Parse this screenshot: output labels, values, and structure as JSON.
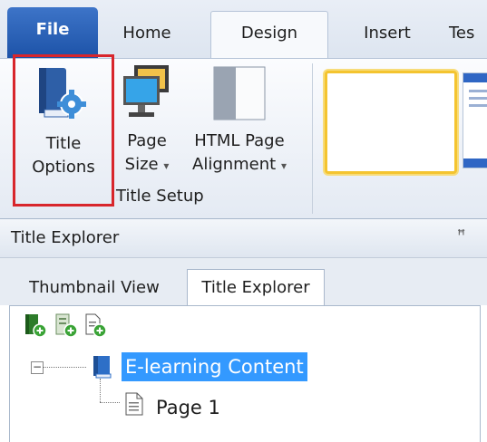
{
  "tabs": {
    "file": "File",
    "home": "Home",
    "design": "Design",
    "insert": "Insert",
    "extra": "Tes"
  },
  "ribbon": {
    "title_options": {
      "line1": "Title",
      "line2": "Options"
    },
    "page_size": {
      "line1": "Page",
      "line2": "Size"
    },
    "html_alignment": {
      "line1": "HTML Page",
      "line2": "Alignment"
    },
    "dropdown_glyph": "▾",
    "group_label": "Title Setup"
  },
  "panel": {
    "title": "Title Explorer",
    "pin_glyph": "ꟸ",
    "subtabs": {
      "thumbnail": "Thumbnail View",
      "explorer": "Title Explorer"
    }
  },
  "tree": {
    "root_label": "E-learning Content",
    "child_label": "Page 1",
    "collapse_glyph": "−"
  },
  "colors": {
    "accent_blue": "#1d53a8",
    "selection": "#3399ff",
    "highlight_red": "#d8262c",
    "theme_yellow": "#f4c430"
  }
}
